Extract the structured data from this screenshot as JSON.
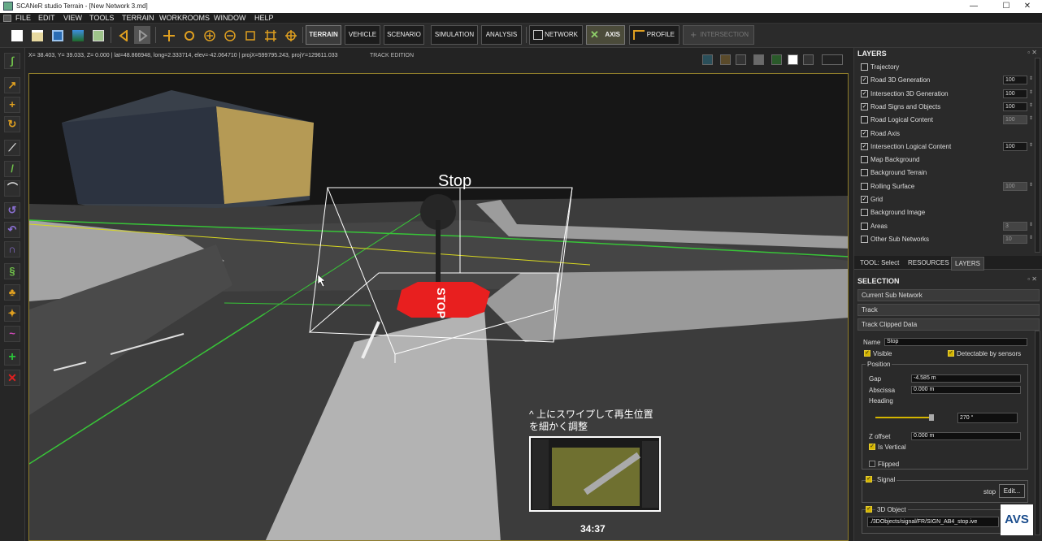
{
  "window": {
    "title": "SCANeR studio Terrain - [New Network 3.md]",
    "minimize": "—",
    "maximize": "☐",
    "close": "✕"
  },
  "menu": [
    {
      "label": "FILE"
    },
    {
      "label": "EDIT"
    },
    {
      "label": "VIEW"
    },
    {
      "label": "TOOLS"
    },
    {
      "label": "TERRAIN"
    },
    {
      "label": "WORKROOMS"
    },
    {
      "label": "WINDOW"
    },
    {
      "label": "HELP"
    }
  ],
  "toolbar": {
    "workspace_buttons": [
      {
        "label": "TERRAIN"
      },
      {
        "label": "VEHICLE"
      },
      {
        "label": "SCENARIO"
      },
      {
        "label": "SIMULATION"
      },
      {
        "label": "ANALYSIS"
      }
    ],
    "network_label": "NETWORK",
    "axis_label": "AXIS",
    "profile_label": "PROFILE",
    "intersection_label": "INTERSECTION"
  },
  "coords": {
    "readout": "X=  38.403, Y=  39.033, Z=   0.000 | lat=48.866948, long=2.333714, elev=-42.064710 | projX=599795.243, projY=129611.033",
    "mode": "TRACK EDITION"
  },
  "viewport": {
    "sign_label": "Stop",
    "sign_face": "STOP",
    "swipe_hint_line1": "^ 上にスワイプして再生位置",
    "swipe_hint_line2": "を細かく調整",
    "timestamp": "34:37"
  },
  "layers": {
    "title": "LAYERS",
    "items": [
      {
        "label": "Trajectory",
        "checked": false,
        "value": ""
      },
      {
        "label": "Road 3D Generation",
        "checked": true,
        "value": "100"
      },
      {
        "label": "Intersection 3D Generation",
        "checked": true,
        "value": "100"
      },
      {
        "label": "Road Signs and Objects",
        "checked": true,
        "value": "100"
      },
      {
        "label": "Road Logical Content",
        "checked": false,
        "value": "100"
      },
      {
        "label": "Road Axis",
        "checked": true,
        "value": ""
      },
      {
        "label": "Intersection Logical Content",
        "checked": true,
        "value": "100"
      },
      {
        "label": "Map Background",
        "checked": false,
        "value": ""
      },
      {
        "label": "Background Terrain",
        "checked": false,
        "value": ""
      },
      {
        "label": "Rolling Surface",
        "checked": false,
        "value": "100"
      },
      {
        "label": "Grid",
        "checked": true,
        "value": ""
      },
      {
        "label": "Background Image",
        "checked": false,
        "value": ""
      },
      {
        "label": "Areas",
        "checked": false,
        "value": "3"
      },
      {
        "label": "Other Sub Networks",
        "checked": false,
        "value": "10"
      }
    ]
  },
  "tabs": [
    {
      "label": "TOOL: Select"
    },
    {
      "label": "RESOURCES"
    },
    {
      "label": "LAYERS"
    }
  ],
  "selection": {
    "title": "SELECTION",
    "rows": [
      "Current Sub Network",
      "Track",
      "Track Clipped Data"
    ],
    "name_label": "Name",
    "name_value": "Stop",
    "visible_label": "Visible",
    "detectable_label": "Detectable by sensors",
    "position_label": "Position",
    "gap_label": "Gap",
    "gap_value": "-4.585 m",
    "abscissa_label": "Abscissa",
    "abscissa_value": "0.000 m",
    "heading_label": "Heading",
    "heading_value": "270 °",
    "zoffset_label": "Z offset",
    "zoffset_value": "0.000 m",
    "vertical_label": "Is Vertical",
    "flipped_label": "Flipped",
    "signal_label": "Signal",
    "signal_value": "stop",
    "edit_label": "Edit...",
    "object3d_label": "3D Object",
    "object3d_path": "./3DObjects/signal/FR/SIGN_AB4_stop.ive"
  },
  "logo": "AVS"
}
